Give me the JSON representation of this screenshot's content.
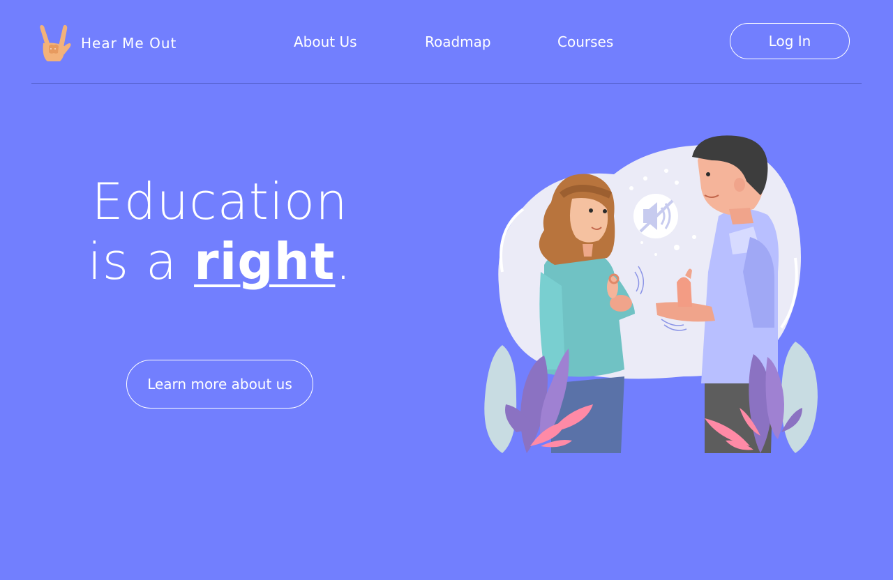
{
  "header": {
    "brand": "Hear Me Out",
    "logo_icon": "sign-language-hand-icon",
    "nav": [
      {
        "label": "About Us"
      },
      {
        "label": "Roadmap"
      },
      {
        "label": "Courses"
      }
    ],
    "login_label": "Log In"
  },
  "hero": {
    "headline_line1": "Education",
    "headline_line2_prefix": "is a ",
    "headline_line2_emphasis": "right",
    "headline_line2_suffix": ".",
    "cta_label": "Learn more about us",
    "illustration": "two-people-sign-language-illustration"
  },
  "colors": {
    "background": "#727ffe",
    "text": "#ffffff",
    "divider": "#5560cc"
  }
}
